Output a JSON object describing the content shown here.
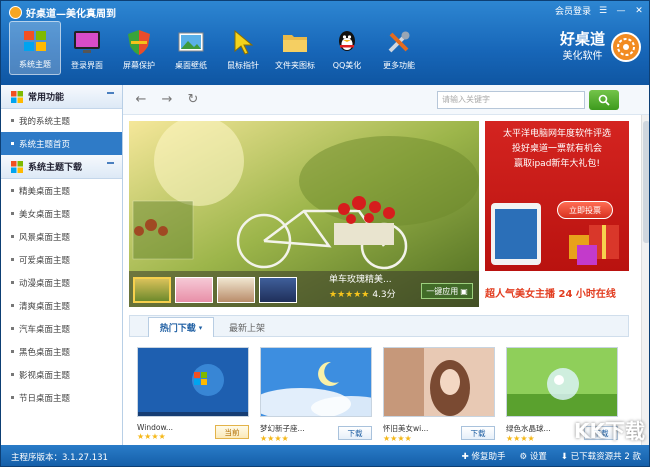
{
  "app": {
    "title": "好桌道—美化真周到"
  },
  "window": {
    "login": "会员登录",
    "menu": "☰",
    "minimize": "—",
    "close": "✕"
  },
  "toolbar": [
    {
      "label": "系统主题",
      "icon": "windows-logo-icon"
    },
    {
      "label": "登录界面",
      "icon": "monitor-icon"
    },
    {
      "label": "屏幕保护",
      "icon": "shield-icon"
    },
    {
      "label": "桌面壁纸",
      "icon": "wallpaper-icon"
    },
    {
      "label": "鼠标指针",
      "icon": "cursor-icon"
    },
    {
      "label": "文件夹图标",
      "icon": "folder-icon"
    },
    {
      "label": "QQ美化",
      "icon": "qq-penguin-icon"
    },
    {
      "label": "更多功能",
      "icon": "tools-icon"
    }
  ],
  "brand": {
    "line1": "好桌道",
    "line2": "美化软件"
  },
  "sidebar": {
    "sec1": "常用功能",
    "items1": [
      {
        "label": "我的系统主题"
      },
      {
        "label": "系统主题首页"
      }
    ],
    "sec2": "系统主题下载",
    "items2": [
      {
        "label": "精美桌面主题"
      },
      {
        "label": "美女桌面主题"
      },
      {
        "label": "风景桌面主题"
      },
      {
        "label": "可爱桌面主题"
      },
      {
        "label": "动漫桌面主题"
      },
      {
        "label": "清爽桌面主题"
      },
      {
        "label": "汽车桌面主题"
      },
      {
        "label": "黑色桌面主题"
      },
      {
        "label": "影视桌面主题"
      },
      {
        "label": "节日桌面主题"
      }
    ]
  },
  "search": {
    "placeholder": "请输入关键字"
  },
  "banner": {
    "title": "单车玫瑰精美...",
    "stars": "★★★★★",
    "score": "4.3分",
    "apply": "一键应用"
  },
  "ad": {
    "line1": "太平洋电脑网年度软件评选",
    "line2": "投好桌道一票就有机会",
    "line3": "赢取ipad新年大礼包!",
    "button": "立即投票",
    "link": "超人气美女主播 24 小时在线"
  },
  "tabs": {
    "hot": "热门下载",
    "new": "最新上架"
  },
  "cards": [
    {
      "name": "Window...",
      "stars": "★★★★",
      "btn": "当前"
    },
    {
      "name": "梦幻新子座...",
      "stars": "★★★★",
      "btn": "下载"
    },
    {
      "name": "怀旧美女wi...",
      "stars": "★★★★",
      "btn": "下载"
    },
    {
      "name": "绿色水晶球...",
      "stars": "★★★★",
      "btn": "下载"
    }
  ],
  "status": {
    "version": "主程序版本：3.1.27.131",
    "repair": "修复助手",
    "settings": "设置",
    "downloads": "已下载资源共 2 款"
  },
  "watermark": "KK下载"
}
